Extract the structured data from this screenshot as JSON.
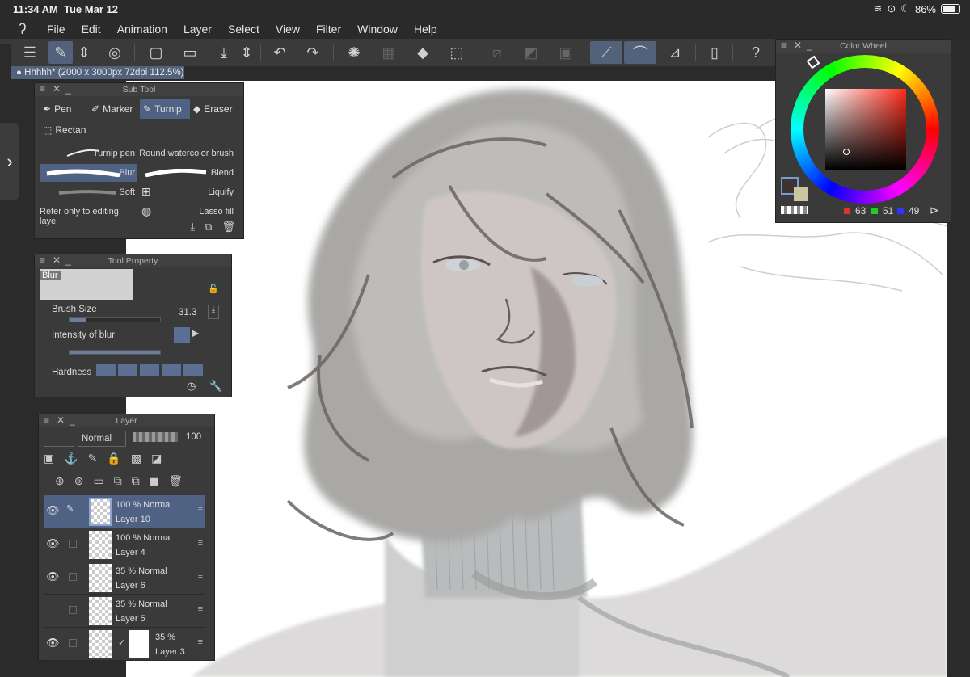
{
  "status_bar": {
    "time": "11:34 AM",
    "date": "Tue Mar 12",
    "battery": "86%"
  },
  "menu": [
    "File",
    "Edit",
    "Animation",
    "Layer",
    "Select",
    "View",
    "Filter",
    "Window",
    "Help"
  ],
  "document_tab": "Hhhhh* (2000 x 3000px 72dpi 112.5%)",
  "sub_tool": {
    "title": "Sub Tool",
    "tabs": [
      "Pen",
      "Marker",
      "Turnip",
      "Eraser",
      "Rectan"
    ],
    "active_tab": "Turnip",
    "brushes": [
      "Turnip pen",
      "Round watercolor brush",
      "Blur",
      "Blend",
      "Soft",
      "Liquify",
      "Refer only to editing laye",
      "Lasso fill"
    ],
    "selected_brush": "Blur"
  },
  "tool_property": {
    "title": "Tool Property",
    "preview_label": "Blur",
    "brush_size_label": "Brush Size",
    "brush_size_value": "31.3",
    "brush_size_fraction": 0.18,
    "intensity_label": "Intensity of blur",
    "intensity_fraction": 1.0,
    "hardness_label": "Hardness"
  },
  "layer_panel": {
    "title": "Layer",
    "blend_mode": "Normal",
    "opacity": "100",
    "layers": [
      {
        "opacity": "100 %",
        "mode": "Normal",
        "name": "Layer 10",
        "visible": true,
        "selected": true
      },
      {
        "opacity": "100 %",
        "mode": "Normal",
        "name": "Layer 4",
        "visible": true,
        "selected": false
      },
      {
        "opacity": "35 %",
        "mode": "Normal",
        "name": "Layer 6",
        "visible": true,
        "selected": false
      },
      {
        "opacity": "35 %",
        "mode": "Normal",
        "name": "Layer 5",
        "visible": false,
        "selected": false
      },
      {
        "opacity": "35 %",
        "mode": "",
        "name": "Layer 3",
        "visible": true,
        "selected": false
      }
    ]
  },
  "color_wheel": {
    "title": "Color Wheel",
    "r": "63",
    "g": "51",
    "b": "49",
    "main_color": "#3f3331",
    "sub_color": "#c8c7a0",
    "hue_color": "#ff2a1a"
  }
}
